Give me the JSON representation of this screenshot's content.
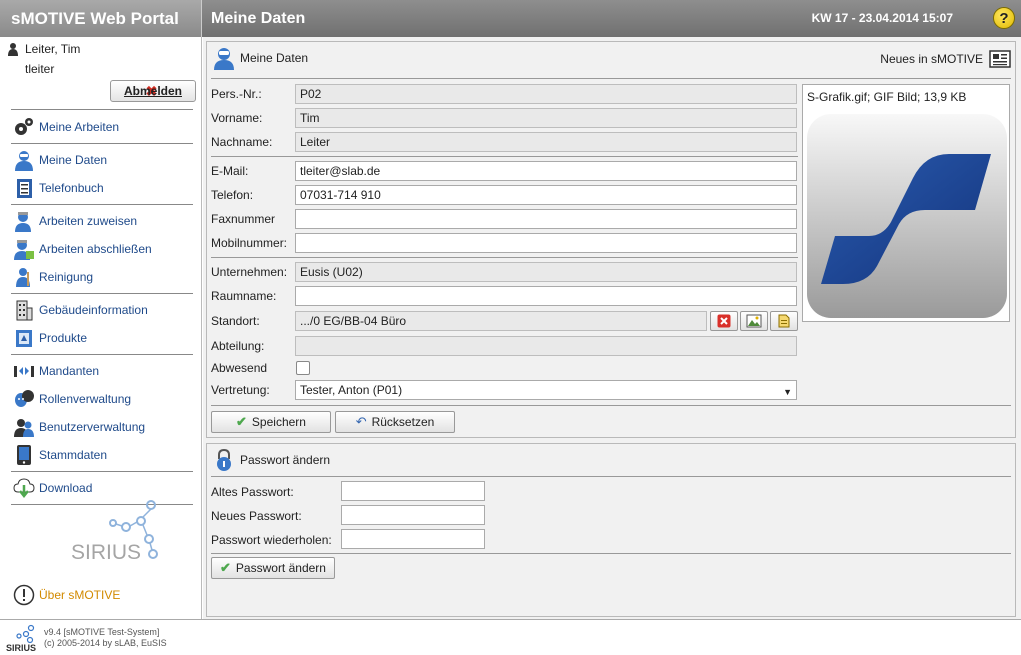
{
  "header": {
    "brand": "sMOTIVE Web Portal",
    "title": "Meine Daten",
    "week_date": "KW 17 - 23.04.2014 15:07",
    "help": "?"
  },
  "sidebar": {
    "user_name": "Leiter, Tim",
    "user_login": "tleiter",
    "logout_label": "Abmelden",
    "items": [
      {
        "label": "Meine Arbeiten",
        "icon": "gears-icon"
      },
      {
        "label": "Meine Daten",
        "icon": "user-icon"
      },
      {
        "label": "Telefonbuch",
        "icon": "phonebook-icon"
      },
      {
        "label": "Arbeiten zuweisen",
        "icon": "worker-assign-icon"
      },
      {
        "label": "Arbeiten abschließen",
        "icon": "worker-done-icon"
      },
      {
        "label": "Reinigung",
        "icon": "cleaning-icon"
      },
      {
        "label": "Gebäudeinformation",
        "icon": "building-icon"
      },
      {
        "label": "Produkte",
        "icon": "products-icon"
      },
      {
        "label": "Mandanten",
        "icon": "clients-icon"
      },
      {
        "label": "Rollenverwaltung",
        "icon": "masks-icon"
      },
      {
        "label": "Benutzerverwaltung",
        "icon": "users-icon"
      },
      {
        "label": "Stammdaten",
        "icon": "master-data-icon"
      },
      {
        "label": "Download",
        "icon": "download-icon"
      }
    ],
    "logo_text": "SIRIUS",
    "about_label": "Über sMOTIVE"
  },
  "main": {
    "panel_title": "Meine Daten",
    "news_label": "Neues in sMOTIVE",
    "fields": {
      "persnr": {
        "label": "Pers.-Nr.:",
        "value": "P02"
      },
      "vorname": {
        "label": "Vorname:",
        "value": "Tim"
      },
      "nachname": {
        "label": "Nachname:",
        "value": "Leiter"
      },
      "email": {
        "label": "E-Mail:",
        "value": "tleiter@slab.de"
      },
      "telefon": {
        "label": "Telefon:",
        "value": "07031-714 910"
      },
      "fax": {
        "label": "Faxnummer",
        "value": ""
      },
      "mobil": {
        "label": "Mobilnummer:",
        "value": ""
      },
      "unternehmen": {
        "label": "Unternehmen:",
        "value": "Eusis (U02)"
      },
      "raum": {
        "label": "Raumname:",
        "value": ""
      },
      "standort": {
        "label": "Standort:",
        "value": ".../0 EG/BB-04 Büro"
      },
      "abteilung": {
        "label": "Abteilung:",
        "value": ""
      },
      "abwesend": {
        "label": "Abwesend",
        "checked": false
      },
      "vertretung": {
        "label": "Vertretung:",
        "value": "Tester, Anton (P01)"
      }
    },
    "image_caption": "S-Grafik.gif; GIF Bild; 13,9 KB",
    "save_label": "Speichern",
    "reset_label": "Rücksetzen"
  },
  "password": {
    "title": "Passwort ändern",
    "old_label": "Altes Passwort:",
    "new_label": "Neues Passwort:",
    "repeat_label": "Passwort wiederholen:",
    "button_label": "Passwort ändern"
  },
  "footer": {
    "version": "v9.4 [sMOTIVE Test-System]",
    "copyright": "(c) 2005-2014 by sLAB, EuSIS",
    "logo_text": "SIRIUS"
  },
  "colors": {
    "nav_link": "#1f4a8a",
    "about_link": "#d28a00",
    "logo_blue": "#1e4591",
    "header_gray": "#7f7f7f"
  }
}
